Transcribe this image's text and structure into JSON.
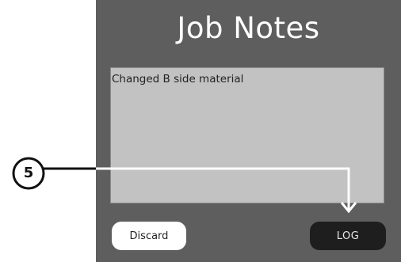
{
  "dialog": {
    "title": "Job Notes",
    "notes_value": "Changed B side material",
    "discard_label": "Discard",
    "log_label": "LOG"
  },
  "callout": {
    "number": "5"
  },
  "colors": {
    "panel_bg": "#5e5e5e",
    "notes_bg": "#c2c2c2",
    "discard_bg": "#ffffff",
    "log_bg": "#1e1e1e"
  }
}
